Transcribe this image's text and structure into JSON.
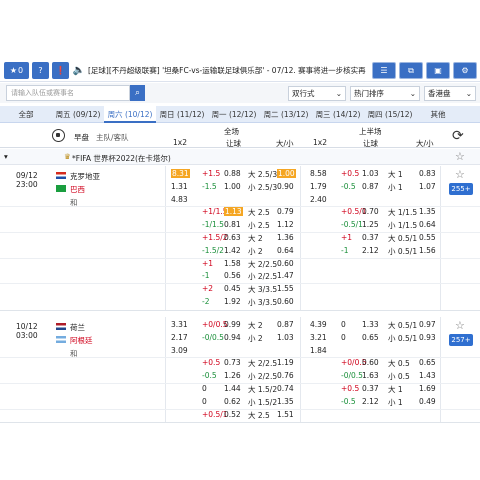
{
  "toolbar": {
    "count": "0",
    "help": "?",
    "marquee": "[足球][不丹超级联赛] '坦桑FC-vs-运输联足球俱乐部' - 07/12. 赛事将进一步核实再"
  },
  "search": {
    "placeholder": "请输入队伍或赛事名",
    "odds_type": "双行式",
    "sort": "热门排序",
    "odds_format": "香港盘"
  },
  "day_tabs": [
    "全部",
    "周五 (09/12)",
    "周六 (10/12)",
    "周日 (11/12)",
    "周一 (12/12)",
    "周二 (13/12)",
    "周三 (14/12)",
    "周四 (15/12)",
    "其他"
  ],
  "active_tab": 2,
  "header": {
    "early": "早盘",
    "teams": "主队/客队",
    "full": "全场",
    "half": "上半场",
    "c1": "1x2",
    "c2": "让球",
    "c3": "大/小",
    "h1": "1x2",
    "h2": "让球",
    "h3": "大/小"
  },
  "league": "*FIFA 世界杯2022(在卡塔尔)",
  "matches": [
    {
      "date": "09/12",
      "time": "23:00",
      "home": "克罗地亚",
      "away": "巴西",
      "draw": "和",
      "more": "255+",
      "rows": [
        [
          "8.31",
          "+1.5",
          "0.88",
          "大 2.5/3",
          "1.00",
          "8.58",
          "+0.5",
          "1.03",
          "大 1",
          "0.83"
        ],
        [
          "1.31",
          "-1.5",
          "1.00",
          "小 2.5/3",
          "0.90",
          "1.79",
          "-0.5",
          "0.87",
          "小 1",
          "1.07"
        ],
        [
          "4.83",
          "",
          "",
          "",
          "",
          "2.40",
          "",
          "",
          "",
          ""
        ],
        [
          "",
          "+1/1.5",
          "1.13",
          "大 2.5",
          "0.79",
          "",
          "+0.5/1",
          "0.70",
          "大 1/1.5",
          "1.35"
        ],
        [
          "",
          "-1/1.5",
          "0.81",
          "小 2.5",
          "1.12",
          "",
          "-0.5/1",
          "1.25",
          "小 1/1.5",
          "0.64"
        ],
        [
          "",
          "+1.5/2",
          "0.63",
          "大 2",
          "1.36",
          "",
          "+1",
          "0.37",
          "大 0.5/1",
          "0.55"
        ],
        [
          "",
          "-1.5/2",
          "1.42",
          "小 2",
          "0.64",
          "",
          "-1",
          "2.12",
          "小 0.5/1",
          "1.56"
        ],
        [
          "",
          "+1",
          "1.58",
          "大 2/2.5",
          "0.60",
          "",
          "",
          "",
          "",
          ""
        ],
        [
          "",
          "-1",
          "0.56",
          "小 2/2.5",
          "1.47",
          "",
          "",
          "",
          "",
          ""
        ],
        [
          "",
          "+2",
          "0.45",
          "大 3/3.5",
          "1.55",
          "",
          "",
          "",
          "",
          ""
        ],
        [
          "",
          "-2",
          "1.92",
          "小 3/3.5",
          "0.60",
          "",
          "",
          "",
          "",
          ""
        ]
      ]
    },
    {
      "date": "10/12",
      "time": "03:00",
      "home": "荷兰",
      "away": "阿根廷",
      "draw": "和",
      "more": "257+",
      "rows": [
        [
          "3.31",
          "+0/0.5",
          "0.99",
          "大 2",
          "0.87",
          "4.39",
          "0",
          "1.33",
          "大 0.5/1",
          "0.97"
        ],
        [
          "2.17",
          "-0/0.5",
          "0.94",
          "小 2",
          "1.03",
          "3.21",
          "0",
          "0.65",
          "小 0.5/1",
          "0.93"
        ],
        [
          "3.09",
          "",
          "",
          "",
          "",
          "1.84",
          "",
          "",
          "",
          ""
        ],
        [
          "",
          "+0.5",
          "0.73",
          "大 2/2.5",
          "1.19",
          "",
          "+0/0.5",
          "0.60",
          "大 0.5",
          "0.65"
        ],
        [
          "",
          "-0.5",
          "1.26",
          "小 2/2.5",
          "0.76",
          "",
          "-0/0.5",
          "1.63",
          "小 0.5",
          "1.43"
        ],
        [
          "",
          "0",
          "1.44",
          "大 1.5/2",
          "0.74",
          "",
          "+0.5",
          "0.37",
          "大 1",
          "1.69"
        ],
        [
          "",
          "0",
          "0.62",
          "小 1.5/2",
          "1.35",
          "",
          "-0.5",
          "2.12",
          "小 1",
          "0.49"
        ],
        [
          "",
          "+0.5/1",
          "0.52",
          "大 2.5",
          "1.51",
          "",
          "",
          "",
          "",
          ""
        ]
      ]
    }
  ],
  "colors": {
    "accent": "#3a6fc4",
    "highlight": "#f5a623",
    "positive": "#d0021b",
    "negative": "#1a8f3a"
  }
}
